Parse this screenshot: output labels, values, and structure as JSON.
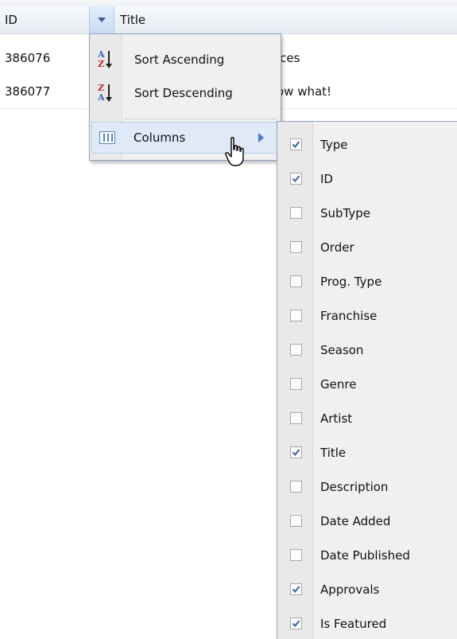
{
  "grid": {
    "columns": [
      {
        "label": "ID"
      },
      {
        "label": "Title"
      }
    ],
    "rows": [
      {
        "id": "386076",
        "title_visible": "ices"
      },
      {
        "id": "386077",
        "title_visible": "ow what!"
      }
    ]
  },
  "context_menu": {
    "items": [
      {
        "label": "Sort Ascending",
        "icon": "sort-ascending-icon"
      },
      {
        "label": "Sort Descending",
        "icon": "sort-descending-icon"
      },
      {
        "label": "Columns",
        "icon": "columns-icon",
        "has_submenu": true,
        "highlighted": true
      }
    ]
  },
  "columns_submenu": {
    "items": [
      {
        "label": "Type",
        "checked": true
      },
      {
        "label": "ID",
        "checked": true
      },
      {
        "label": "SubType",
        "checked": false
      },
      {
        "label": "Order",
        "checked": false
      },
      {
        "label": "Prog. Type",
        "checked": false
      },
      {
        "label": "Franchise",
        "checked": false
      },
      {
        "label": "Season",
        "checked": false
      },
      {
        "label": "Genre",
        "checked": false
      },
      {
        "label": "Artist",
        "checked": false
      },
      {
        "label": "Title",
        "checked": true
      },
      {
        "label": "Description",
        "checked": false
      },
      {
        "label": "Date Added",
        "checked": false
      },
      {
        "label": "Date Published",
        "checked": false
      },
      {
        "label": "Approvals",
        "checked": true
      },
      {
        "label": "Is Featured",
        "checked": true
      }
    ]
  },
  "colors": {
    "accent": "#4a78c4",
    "menu_background": "#f0f0f0",
    "highlight": "#dfe9f7",
    "check": "#3a5fa8"
  }
}
